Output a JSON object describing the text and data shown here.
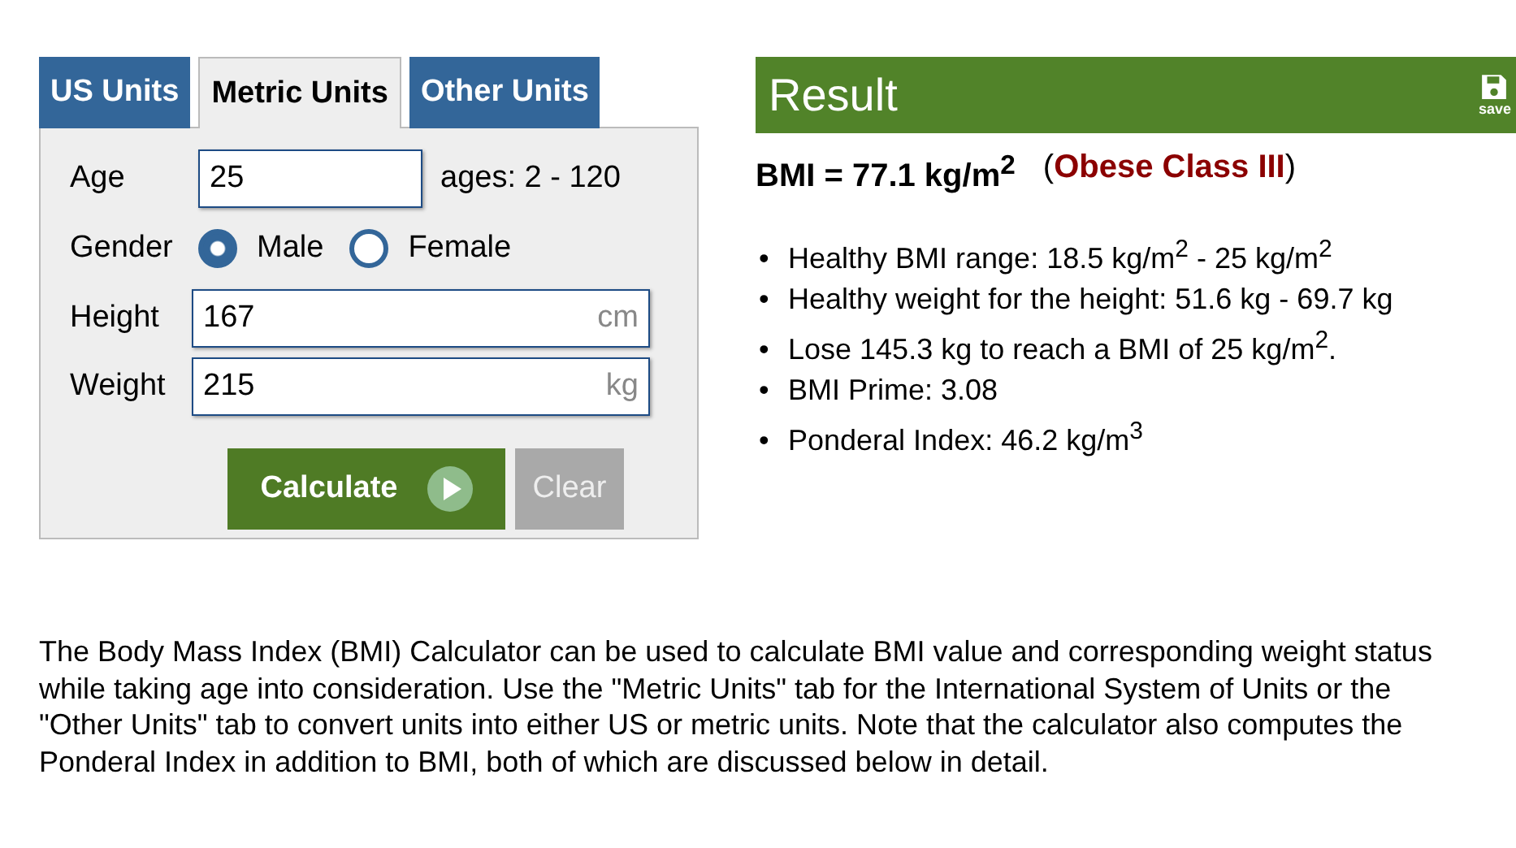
{
  "tabs": [
    {
      "label": "US Units",
      "selected": false
    },
    {
      "label": "Metric Units",
      "selected": true
    },
    {
      "label": "Other Units",
      "selected": false
    }
  ],
  "form": {
    "age": {
      "label": "Age",
      "value": "25",
      "hint": "ages: 2 - 120"
    },
    "gender": {
      "label": "Gender",
      "options": [
        {
          "label": "Male",
          "selected": true
        },
        {
          "label": "Female",
          "selected": false
        }
      ]
    },
    "height": {
      "label": "Height",
      "value": "167",
      "unit": "cm"
    },
    "weight": {
      "label": "Weight",
      "value": "215",
      "unit": "kg"
    },
    "calculate_button": "Calculate",
    "clear_button": "Clear"
  },
  "result": {
    "title": "Result",
    "save_label": "save",
    "bmi": "BMI = 77.1 kg/m$^{2}$",
    "category_open": "(",
    "category": "Obese Class III",
    "category_close": ")",
    "bullet": "•",
    "details": [
      "Healthy BMI range: 18.5 kg/m$^{2}$ - 25 kg/m$^{2}$",
      "Healthy weight for the height: 51.6 kg - 69.7 kg",
      "Lose 145.3 kg to reach a BMI of 25 kg/m$^{2}$.",
      "BMI Prime: 3.08",
      "Ponderal Index: 46.2 kg/m$^{3}$"
    ]
  },
  "description": "The Body Mass Index (BMI) Calculator can be used to calculate BMI value and corresponding weight status while taking age into consideration. Use the \"Metric Units\" tab for the International System of Units or the \"Other Units\" tab to convert units into either US or metric units. Note that the calculator also computes the Ponderal Index in addition to BMI, both of which are discussed below in detail."
}
